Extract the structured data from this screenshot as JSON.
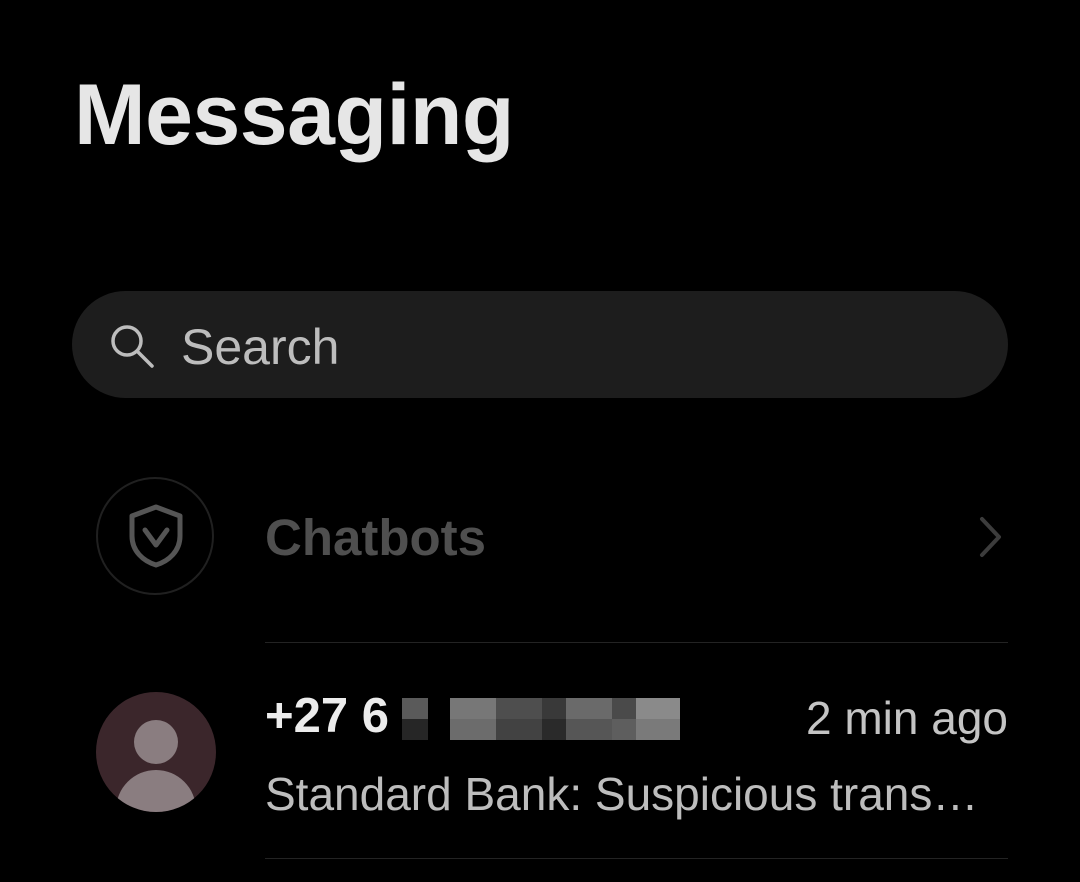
{
  "header": {
    "title": "Messaging"
  },
  "search": {
    "placeholder": "Search",
    "icon": "search-icon"
  },
  "chatbots": {
    "label": "Chatbots",
    "icon": "shield-check-icon",
    "trailing_icon": "chevron-right-icon"
  },
  "conversations": [
    {
      "sender": "+27 6",
      "sender_redacted": true,
      "timestamp": "2 min ago",
      "preview": "Standard Bank: Suspicious trans…",
      "avatar_icon": "person-icon"
    }
  ],
  "colors": {
    "background": "#000000",
    "search_bg": "#1d1d1d",
    "avatar_bg": "#3b262b",
    "avatar_fg": "#8a7d80",
    "chatbots_text": "#4f4f4f"
  }
}
